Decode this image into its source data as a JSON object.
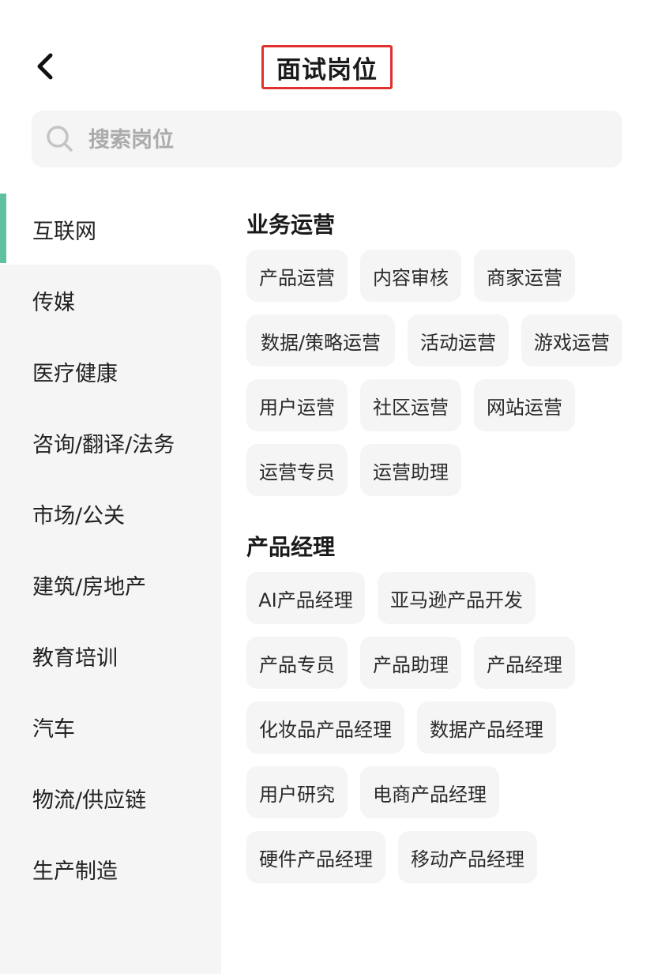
{
  "header": {
    "title": "面试岗位",
    "back_icon": "chevron-left-icon"
  },
  "search": {
    "placeholder": "搜索岗位",
    "icon": "search-icon"
  },
  "sidebar": {
    "accent_color": "#5ec2a2",
    "items": [
      {
        "label": "互联网",
        "active": true
      },
      {
        "label": "传媒"
      },
      {
        "label": "医疗健康"
      },
      {
        "label": "咨询/翻译/法务"
      },
      {
        "label": "市场/公关"
      },
      {
        "label": "建筑/房地产"
      },
      {
        "label": "教育培训"
      },
      {
        "label": "汽车"
      },
      {
        "label": "物流/供应链"
      },
      {
        "label": "生产制造"
      }
    ]
  },
  "sections": [
    {
      "title": "业务运营",
      "chips": [
        "产品运营",
        "内容审核",
        "商家运营",
        "数据/策略运营",
        "活动运营",
        "游戏运营",
        "用户运营",
        "社区运营",
        "网站运营",
        "运营专员",
        "运营助理"
      ]
    },
    {
      "title": "产品经理",
      "chips": [
        "AI产品经理",
        "亚马逊产品开发",
        "产品专员",
        "产品助理",
        "产品经理",
        "化妆品产品经理",
        "数据产品经理",
        "用户研究",
        "电商产品经理",
        "硬件产品经理",
        "移动产品经理"
      ]
    }
  ]
}
